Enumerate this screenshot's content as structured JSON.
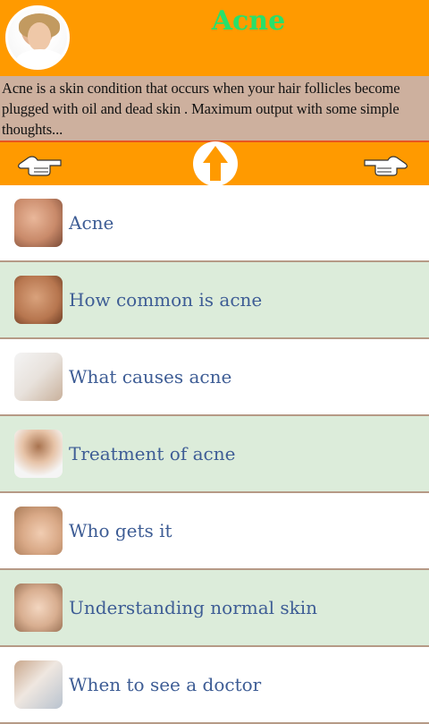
{
  "header": {
    "title": "Acne",
    "avatar_icon": "woman-applying-cream-icon",
    "title_color": "#28e06a",
    "background_color": "#ff9a00"
  },
  "description": {
    "text": "Acne is a skin condition that occurs when your hair follicles become plugged with oil and dead skin . Maximum output with some simple thoughts..."
  },
  "navbar": {
    "left_icon": "hand-pointing-left-icon",
    "center_icon": "up-arrow-icon",
    "right_icon": "hand-pointing-right-icon"
  },
  "menu": {
    "items": [
      {
        "label": "Acne",
        "thumb_icon": "acne-face-thumbnail"
      },
      {
        "label": "How common is acne",
        "thumb_icon": "skin-closeup-thumbnail"
      },
      {
        "label": "What causes acne",
        "thumb_icon": "woman-mirror-thumbnail"
      },
      {
        "label": "Treatment of acne",
        "thumb_icon": "face-washing-thumbnail"
      },
      {
        "label": "Who gets it",
        "thumb_icon": "woman-face-thumbnail"
      },
      {
        "label": "Understanding normal skin",
        "thumb_icon": "smiling-face-thumbnail"
      },
      {
        "label": "When to see a doctor",
        "thumb_icon": "doctor-consult-thumbnail"
      }
    ],
    "label_color": "#3e5d95",
    "alt_row_color": "#dcecda"
  }
}
